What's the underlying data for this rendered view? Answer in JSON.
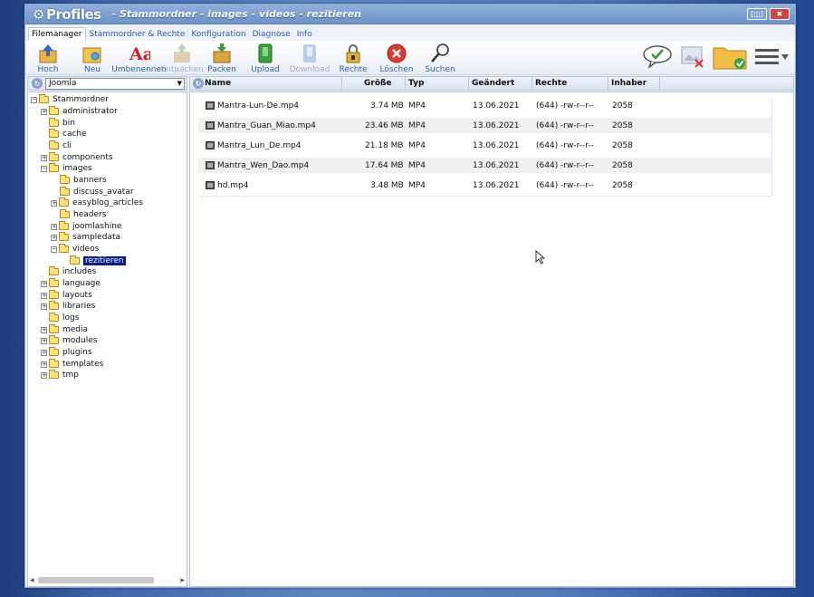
{
  "app": {
    "logo": "Profiles",
    "title": "- Stammordner - images - videos - rezitieren",
    "window_buttons": {
      "restore": "[◫]",
      "close": "✖"
    }
  },
  "tabs": [
    {
      "label": "Filemanager",
      "active": true
    },
    {
      "label": "Stammordner & Rechte",
      "active": false
    },
    {
      "label": "Konfiguration",
      "active": false
    },
    {
      "label": "Diagnose",
      "active": false
    },
    {
      "label": "Info",
      "active": false
    }
  ],
  "toolbar": [
    {
      "label": "Hoch",
      "icon": "folder-up-icon",
      "enabled": true
    },
    {
      "label": "Neu",
      "icon": "new-folder-icon",
      "enabled": true
    },
    {
      "label": "Umbenennen",
      "icon": "rename-icon",
      "enabled": true
    },
    {
      "label": "Entpacken",
      "icon": "unpack-icon",
      "enabled": false
    },
    {
      "label": "Packen",
      "icon": "pack-icon",
      "enabled": true
    },
    {
      "label": "Upload",
      "icon": "upload-icon",
      "enabled": true
    },
    {
      "label": "Download",
      "icon": "download-icon",
      "enabled": false
    },
    {
      "label": "Rechte",
      "icon": "lock-icon",
      "enabled": true
    },
    {
      "label": "Löschen",
      "icon": "delete-icon",
      "enabled": true
    },
    {
      "label": "Suchen",
      "icon": "search-icon",
      "enabled": true
    }
  ],
  "tree": {
    "dropdown_value": "Joomla",
    "nodes": [
      {
        "label": "Stammordner",
        "level": 0,
        "expander": "minus"
      },
      {
        "label": "administrator",
        "level": 1,
        "expander": "plus"
      },
      {
        "label": "bin",
        "level": 1,
        "expander": "none"
      },
      {
        "label": "cache",
        "level": 1,
        "expander": "none"
      },
      {
        "label": "cli",
        "level": 1,
        "expander": "none"
      },
      {
        "label": "components",
        "level": 1,
        "expander": "plus"
      },
      {
        "label": "images",
        "level": 1,
        "expander": "minus"
      },
      {
        "label": "banners",
        "level": 2,
        "expander": "none"
      },
      {
        "label": "discuss_avatar",
        "level": 2,
        "expander": "none"
      },
      {
        "label": "easyblog_articles",
        "level": 2,
        "expander": "plus"
      },
      {
        "label": "headers",
        "level": 2,
        "expander": "none"
      },
      {
        "label": "joomlashine",
        "level": 2,
        "expander": "plus"
      },
      {
        "label": "sampledata",
        "level": 2,
        "expander": "plus"
      },
      {
        "label": "videos",
        "level": 2,
        "expander": "minus"
      },
      {
        "label": "rezitieren",
        "level": 3,
        "expander": "none",
        "selected": true
      },
      {
        "label": "includes",
        "level": 1,
        "expander": "none"
      },
      {
        "label": "language",
        "level": 1,
        "expander": "plus"
      },
      {
        "label": "layouts",
        "level": 1,
        "expander": "plus"
      },
      {
        "label": "libraries",
        "level": 1,
        "expander": "plus"
      },
      {
        "label": "logs",
        "level": 1,
        "expander": "none"
      },
      {
        "label": "media",
        "level": 1,
        "expander": "plus"
      },
      {
        "label": "modules",
        "level": 1,
        "expander": "plus"
      },
      {
        "label": "plugins",
        "level": 1,
        "expander": "plus"
      },
      {
        "label": "templates",
        "level": 1,
        "expander": "plus"
      },
      {
        "label": "tmp",
        "level": 1,
        "expander": "plus"
      }
    ]
  },
  "list": {
    "columns": [
      "Name",
      "Größe",
      "Typ",
      "Geändert",
      "Rechte",
      "Inhaber"
    ],
    "files": [
      {
        "name": "Mantra-Lun-De.mp4",
        "size": "3.74 MB",
        "type": "MP4",
        "modified": "13.06.2021",
        "perms": "(644) -rw-r--r--",
        "owner": "2058"
      },
      {
        "name": "Mantra_Guan_Miao.mp4",
        "size": "23.46 MB",
        "type": "MP4",
        "modified": "13.06.2021",
        "perms": "(644) -rw-r--r--",
        "owner": "2058"
      },
      {
        "name": "Mantra_Lun_De.mp4",
        "size": "21.18 MB",
        "type": "MP4",
        "modified": "13.06.2021",
        "perms": "(644) -rw-r--r--",
        "owner": "2058"
      },
      {
        "name": "Mantra_Wen_Dao.mp4",
        "size": "17.64 MB",
        "type": "MP4",
        "modified": "13.06.2021",
        "perms": "(644) -rw-r--r--",
        "owner": "2058"
      },
      {
        "name": "hd.mp4",
        "size": "3.48 MB",
        "type": "MP4",
        "modified": "13.06.2021",
        "perms": "(644) -rw-r--r--",
        "owner": "2058"
      }
    ]
  },
  "colors": {
    "link": "#2b5fb0",
    "selection": "#0a1a8c",
    "title_bar": "#7b9dd0"
  }
}
